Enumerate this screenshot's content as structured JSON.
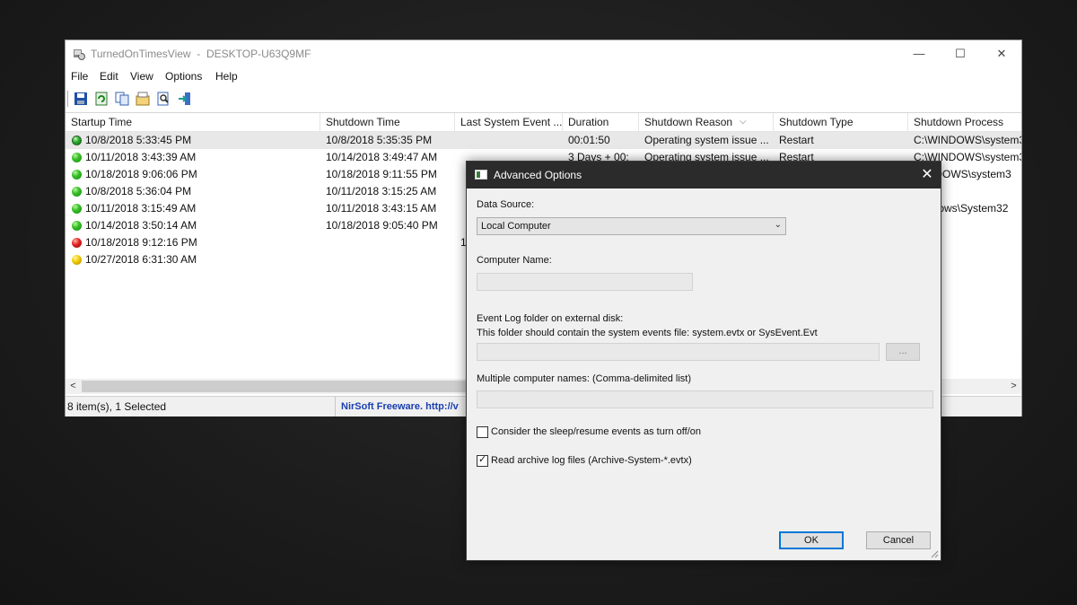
{
  "window": {
    "title": "TurnedOnTimesView",
    "separator": "-",
    "computer": "DESKTOP-U63Q9MF",
    "minimize": "—",
    "maximize": "☐",
    "close": "✕"
  },
  "menu": [
    "File",
    "Edit",
    "View",
    "Options",
    "Help"
  ],
  "toolbar": [
    "save-icon",
    "refresh-icon",
    "copy-icon",
    "properties-icon",
    "find-icon",
    "exit-icon"
  ],
  "columns": [
    "Startup Time",
    "Shutdown Time",
    "Last System Event ...",
    "Duration",
    "Shutdown Reason",
    "Shutdown Type",
    "Shutdown Process"
  ],
  "sort_indicator": "⌵",
  "rows": [
    {
      "status": "dotted",
      "startup": "10/8/2018 5:33:45 PM",
      "shutdown": "10/8/2018 5:35:35 PM",
      "last_event": "",
      "duration": "00:01:50",
      "reason": "Operating system issue ...",
      "type": "Restart",
      "process": "C:\\WINDOWS\\system3"
    },
    {
      "status": "green",
      "startup": "10/11/2018 3:43:39 AM",
      "shutdown": "10/14/2018 3:49:47 AM",
      "last_event": "",
      "duration": "3 Days + 00:",
      "reason": "Operating system issue ...",
      "type": "Restart",
      "process": "C:\\WINDOWS\\system3"
    },
    {
      "status": "green",
      "startup": "10/18/2018 9:06:06 PM",
      "shutdown": "10/18/2018 9:11:55 PM",
      "last_event": "",
      "duration": "",
      "reason": "",
      "type": "",
      "process": "WINDOWS\\system3"
    },
    {
      "status": "green",
      "startup": "10/8/2018 5:36:04 PM",
      "shutdown": "10/11/2018 3:15:25 AM",
      "last_event": "",
      "duration": "",
      "reason": "",
      "type": "",
      "process": ""
    },
    {
      "status": "green",
      "startup": "10/11/2018 3:15:49 AM",
      "shutdown": "10/11/2018 3:43:15 AM",
      "last_event": "",
      "duration": "",
      "reason": "",
      "type": "",
      "process": "Windows\\System32"
    },
    {
      "status": "green",
      "startup": "10/14/2018 3:50:14 AM",
      "shutdown": "10/18/2018 9:05:40 PM",
      "last_event": "",
      "duration": "",
      "reason": "",
      "type": "",
      "process": ""
    },
    {
      "status": "red",
      "startup": "10/18/2018 9:12:16 PM",
      "shutdown": "",
      "last_event": "1",
      "duration": "",
      "reason": "",
      "type": "",
      "process": ""
    },
    {
      "status": "yellow",
      "startup": "10/27/2018 6:31:30 AM",
      "shutdown": "",
      "last_event": "",
      "duration": "",
      "reason": "",
      "type": "",
      "process": ""
    }
  ],
  "scroll": {
    "left": "<",
    "right": ">"
  },
  "status": {
    "count": "8 item(s), 1 Selected",
    "vendor": "NirSoft Freeware.  http://v"
  },
  "dialog": {
    "title": "Advanced Options",
    "close": "✕",
    "data_source_label": "Data Source:",
    "data_source_value": "Local Computer",
    "computer_name_label": "Computer Name:",
    "computer_name_value": "",
    "event_log_label": "Event Log folder on external disk:",
    "event_log_hint": "This folder should contain the system events file: system.evtx or SysEvent.Evt",
    "event_log_value": "",
    "browse": "...",
    "multi_label": "Multiple computer names: (Comma-delimited list)",
    "multi_value": "",
    "sleep_label": "Consider the sleep/resume events as turn off/on",
    "sleep_checked": false,
    "archive_label": "Read archive log files (Archive-System-*.evtx)",
    "archive_checked": true,
    "ok": "OK",
    "cancel": "Cancel"
  }
}
